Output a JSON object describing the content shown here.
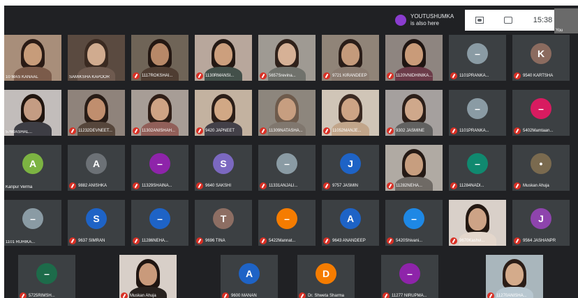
{
  "topbar": {
    "notification_line1": "YOUTUSHUMKA",
    "notification_line2": "is also here",
    "time": "15:38",
    "self_label": "You"
  },
  "tiles": [
    {
      "kind": "video",
      "name": "10 MAS KANAAL",
      "muted": false,
      "skin": "#c79c7a",
      "hair": "#2a1b15",
      "shirt": "#7b5b4a",
      "bg": "#a88e7a"
    },
    {
      "kind": "video",
      "name": "SAMIKSHA KAPOOR",
      "muted": false,
      "skin": "#d0ab8f",
      "hair": "#3a2a21",
      "shirt": "#6e5a4f",
      "bg": "#5a4a40"
    },
    {
      "kind": "video",
      "name": "1117ROKSHAI...",
      "muted": true,
      "skin": "#b78868",
      "hair": "#231712",
      "shirt": "#4f3d32",
      "bg": "#6f6457"
    },
    {
      "kind": "video",
      "name": "1130RMANSI...",
      "muted": true,
      "skin": "#cc9f7d",
      "hair": "#241914",
      "shirt": "#43504a",
      "bg": "#b8a79c"
    },
    {
      "kind": "video",
      "name": "5657Srevina...",
      "muted": true,
      "skin": "#d6b196",
      "hair": "#2f211a",
      "shirt": "#70726c",
      "bg": "#9f9a93"
    },
    {
      "kind": "video",
      "name": "9721 KIRANDEEP",
      "muted": true,
      "skin": "#c49a7b",
      "hair": "#2a1d18",
      "shirt": "#8a7b70",
      "bg": "#908478"
    },
    {
      "kind": "video",
      "name": "1120VNIDHINIKA...",
      "muted": true,
      "skin": "#c99b79",
      "hair": "#1f1512",
      "shirt": "#6b3b48",
      "bg": "#8e8580"
    },
    {
      "kind": "avatar",
      "name": "1101PRANKA...",
      "muted": true,
      "color": "#8a9ba4",
      "letter": "–"
    },
    {
      "kind": "avatar",
      "name": "9540 KARTSHA",
      "muted": true,
      "color": "#8b6b5f",
      "letter": "K"
    },
    {
      "kind": "video",
      "name": "5760ASHAL...",
      "muted": false,
      "skin": "#c49c83",
      "hair": "#20150f",
      "shirt": "#3d3d44",
      "bg": "#c2bdbb"
    },
    {
      "kind": "video",
      "name": "11232DEVNEET...",
      "muted": true,
      "skin": "#c08e6e",
      "hair": "#281c16",
      "shirt": "#56463b",
      "bg": "#8f837b"
    },
    {
      "kind": "video",
      "name": "11302ANISHAH...",
      "muted": true,
      "skin": "#cfa384",
      "hair": "#2f1e17",
      "shirt": "#915f59",
      "bg": "#a79d96"
    },
    {
      "kind": "video",
      "name": "9420 JAPNEET",
      "muted": true,
      "skin": "#d1a885",
      "hair": "#2b1e18",
      "shirt": "#434048",
      "bg": "#c3b2a0"
    },
    {
      "kind": "video",
      "name": "11309NATASHA...",
      "muted": true,
      "skin": "#c79e80",
      "hair": "#6e5b4c",
      "shirt": "#80776e",
      "bg": "#8d867d"
    },
    {
      "kind": "video",
      "name": "11052MANJE...",
      "muted": true,
      "skin": "#cda485",
      "hair": "#3b2a22",
      "shirt": "#c1a58a",
      "bg": "#d0c5b7"
    },
    {
      "kind": "video",
      "name": "9302 JASMINE",
      "muted": true,
      "skin": "#cfa88b",
      "hair": "#2c1f19",
      "shirt": "#616160",
      "bg": "#a5a09e"
    },
    {
      "kind": "avatar",
      "name": "1101PRANKA...",
      "muted": true,
      "color": "#8a9ba4",
      "letter": "–"
    },
    {
      "kind": "avatar",
      "name": "5402Mamtaan...",
      "muted": true,
      "color": "#d81b60",
      "letter": "–"
    },
    {
      "kind": "avatar",
      "name": "Kanpur Verma",
      "muted": false,
      "color": "#7cb342",
      "letter": "A"
    },
    {
      "kind": "avatar",
      "name": "9882 ANISHKA",
      "muted": true,
      "color": "#6c7176",
      "letter": "A"
    },
    {
      "kind": "avatar",
      "name": "11329SHAINA...",
      "muted": true,
      "color": "#8e24aa",
      "letter": "–"
    },
    {
      "kind": "avatar",
      "name": "9640 SAKSHI",
      "muted": true,
      "color": "#7b68c0",
      "letter": "S"
    },
    {
      "kind": "avatar",
      "name": "11331ANJALI...",
      "muted": true,
      "color": "#8a9ba4",
      "letter": "–"
    },
    {
      "kind": "avatar",
      "name": "9757 JASMIN",
      "muted": true,
      "color": "#1e63c6",
      "letter": "J"
    },
    {
      "kind": "video",
      "name": "11282NEHA...",
      "muted": true,
      "skin": "#c79e7f",
      "hair": "#251a15",
      "shirt": "#6f6a65",
      "bg": "#b0aaa3"
    },
    {
      "kind": "avatar",
      "name": "11284NADI...",
      "muted": true,
      "color": "#10896f",
      "letter": "–"
    },
    {
      "kind": "avatar",
      "name": "Muskan Ahuja",
      "muted": true,
      "color": "#7a6a4f",
      "letter": "•"
    },
    {
      "kind": "avatar",
      "name": "1101 RUHIKA...",
      "muted": false,
      "color": "#8a9ba4",
      "letter": "–"
    },
    {
      "kind": "avatar",
      "name": "9637 SIMRAN",
      "muted": true,
      "color": "#1e63c6",
      "letter": "S"
    },
    {
      "kind": "avatar",
      "name": "11286NEHA...",
      "muted": true,
      "color": "#1e63c6",
      "letter": "–"
    },
    {
      "kind": "avatar",
      "name": "9696 TINA",
      "muted": true,
      "color": "#8d6e63",
      "letter": "T"
    },
    {
      "kind": "avatar",
      "name": "5422Mannat...",
      "muted": true,
      "color": "#f57c00",
      "letter": "–"
    },
    {
      "kind": "avatar",
      "name": "9643 ANANDEEP",
      "muted": true,
      "color": "#1e63c6",
      "letter": "A"
    },
    {
      "kind": "avatar",
      "name": "5420Shivani...",
      "muted": true,
      "color": "#1e88e5",
      "letter": "–"
    },
    {
      "kind": "video",
      "name": "9670Kashvi...",
      "muted": true,
      "skin": "#cda386",
      "hair": "#231812",
      "shirt": "#e4d7cc",
      "bg": "#d9d0c9"
    },
    {
      "kind": "avatar",
      "name": "9564 JASHANPR",
      "muted": true,
      "color": "#8e44ad",
      "letter": "J"
    },
    {
      "kind": "avatar",
      "name": "5725RIMSH...",
      "muted": true,
      "color": "#1d6b4a",
      "letter": "–"
    },
    {
      "kind": "video",
      "name": "Muskan Ahuja",
      "muted": true,
      "skin": "#c99a7b",
      "hair": "#1f1511",
      "shirt": "#28221f",
      "bg": "#d8cfc8"
    },
    {
      "kind": "avatar",
      "name": "9600 MANAN",
      "muted": true,
      "color": "#1e63c6",
      "letter": "A"
    },
    {
      "kind": "avatar",
      "name": "Dr. Shweta Sharma",
      "muted": true,
      "color": "#f57c00",
      "letter": "D"
    },
    {
      "kind": "avatar",
      "name": "11277 NIRUPMA...",
      "muted": true,
      "color": "#8e24aa",
      "letter": "–"
    },
    {
      "kind": "video",
      "name": "11270ANISHA...",
      "muted": true,
      "skin": "#d4ab8b",
      "hair": "#2b1d17",
      "shirt": "#b8c7d0",
      "bg": "#a9b6bc"
    }
  ]
}
